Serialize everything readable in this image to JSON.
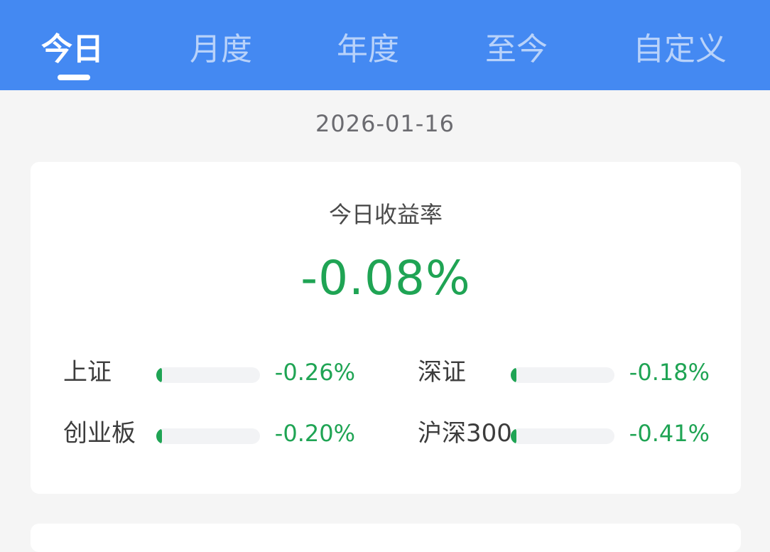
{
  "tabs": [
    {
      "label": "今日",
      "active": true
    },
    {
      "label": "月度",
      "active": false
    },
    {
      "label": "年度",
      "active": false
    },
    {
      "label": "至今",
      "active": false
    },
    {
      "label": "自定义",
      "active": false
    }
  ],
  "date": "2026-01-16",
  "summary": {
    "title": "今日收益率",
    "value": "-0.08%"
  },
  "indices": [
    {
      "name": "上证",
      "value": "-0.26%",
      "bar_percent": 2
    },
    {
      "name": "深证",
      "value": "-0.18%",
      "bar_percent": 2
    },
    {
      "name": "创业板",
      "value": "-0.20%",
      "bar_percent": 2
    },
    {
      "name": "沪深300",
      "value": "-0.41%",
      "bar_percent": 4
    }
  ],
  "colors": {
    "header_bg": "#4489f2",
    "negative": "#1fa454",
    "page_bg": "#f5f5f5",
    "card_bg": "#ffffff"
  }
}
